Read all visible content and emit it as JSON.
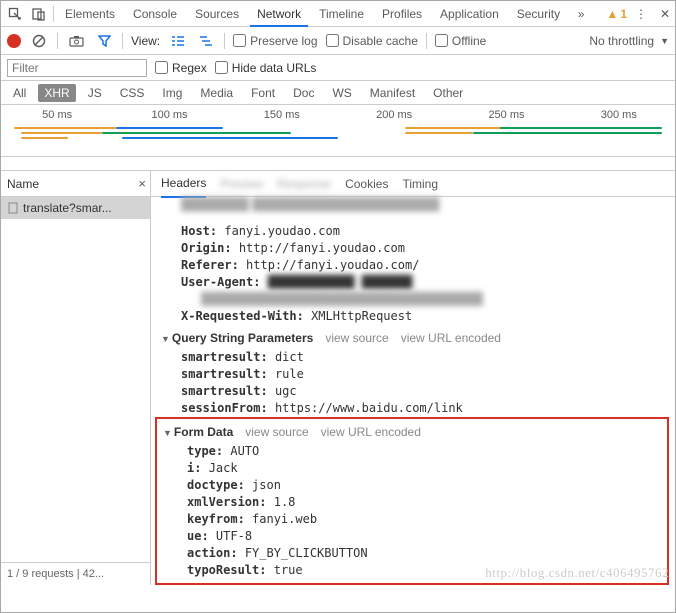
{
  "mainTabs": [
    "Elements",
    "Console",
    "Sources",
    "Network",
    "Timeline",
    "Profiles",
    "Application",
    "Security"
  ],
  "mainActive": "Network",
  "warnings": "1",
  "toolbar": {
    "viewLabel": "View:",
    "preserve": "Preserve log",
    "disableCache": "Disable cache",
    "offline": "Offline",
    "throttle": "No throttling"
  },
  "filter": {
    "placeholder": "Filter",
    "regex": "Regex",
    "hideData": "Hide data URLs"
  },
  "typeFilters": [
    "All",
    "XHR",
    "JS",
    "CSS",
    "Img",
    "Media",
    "Font",
    "Doc",
    "WS",
    "Manifest",
    "Other"
  ],
  "typeActive": "XHR",
  "timeline": [
    "50 ms",
    "100 ms",
    "150 ms",
    "200 ms",
    "250 ms",
    "300 ms"
  ],
  "leftPane": {
    "header": "Name",
    "request": "translate?smar...",
    "status": "1 / 9 requests | 42..."
  },
  "detailTabs": [
    "Headers",
    "Preview",
    "Response",
    "Cookies",
    "Timing"
  ],
  "detailActive": "Headers",
  "headers": {
    "host_l": "Host:",
    "host_v": "fanyi.youdao.com",
    "origin_l": "Origin:",
    "origin_v": "http://fanyi.youdao.com",
    "referer_l": "Referer:",
    "referer_v": "http://fanyi.youdao.com/",
    "ua_l": "User-Agent:",
    "xrw_l": "X-Requested-With:",
    "xrw_v": "XMLHttpRequest"
  },
  "qsSection": {
    "title": "Query String Parameters",
    "viewSource": "view source",
    "viewEncoded": "view URL encoded",
    "rows": [
      {
        "k": "smartresult:",
        "v": "dict"
      },
      {
        "k": "smartresult:",
        "v": "rule"
      },
      {
        "k": "smartresult:",
        "v": "ugc"
      },
      {
        "k": "sessionFrom:",
        "v": "https://www.baidu.com/link"
      }
    ]
  },
  "formSection": {
    "title": "Form Data",
    "viewSource": "view source",
    "viewEncoded": "view URL encoded",
    "rows": [
      {
        "k": "type:",
        "v": "AUTO"
      },
      {
        "k": "i:",
        "v": "Jack"
      },
      {
        "k": "doctype:",
        "v": "json"
      },
      {
        "k": "xmlVersion:",
        "v": "1.8"
      },
      {
        "k": "keyfrom:",
        "v": "fanyi.web"
      },
      {
        "k": "ue:",
        "v": "UTF-8"
      },
      {
        "k": "action:",
        "v": "FY_BY_CLICKBUTTON"
      },
      {
        "k": "typoResult:",
        "v": "true"
      }
    ]
  },
  "watermark": "http://blog.csdn.net/c406495762"
}
